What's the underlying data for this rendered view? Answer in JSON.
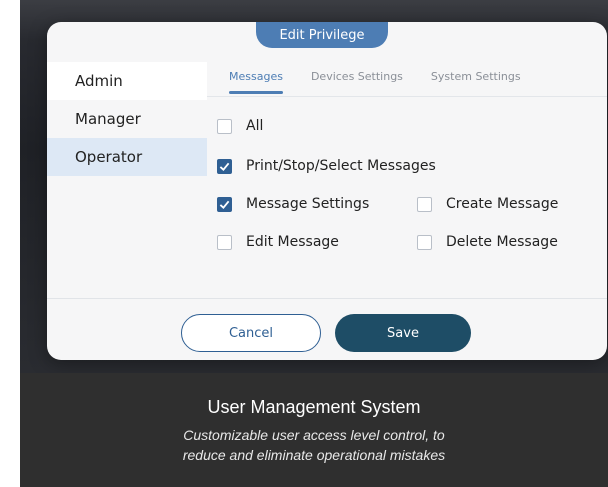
{
  "dialog": {
    "title": "Edit Privilege",
    "roles": [
      "Admin",
      "Manager",
      "Operator"
    ],
    "tabs": [
      "Messages",
      "Devices Settings",
      "System Settings"
    ],
    "options": [
      {
        "label": "All",
        "checked": false
      },
      {
        "label": "Print/Stop/Select Messages",
        "checked": true
      },
      {
        "label": "Message Settings",
        "checked": true
      },
      {
        "label": "Create Message",
        "checked": false
      },
      {
        "label": "Edit Message",
        "checked": false
      },
      {
        "label": "Delete Message",
        "checked": false
      }
    ],
    "cancel_label": "Cancel",
    "save_label": "Save"
  },
  "caption": {
    "title": "User Management System",
    "subtitle_line1": "Customizable user access level control, to",
    "subtitle_line2": "reduce and eliminate operational mistakes"
  },
  "colors": {
    "accent": "#4d7db4",
    "save_button": "#1e4d66",
    "selected_role_bg": "#dde8f5",
    "caption_bg": "#2f2f2f"
  }
}
